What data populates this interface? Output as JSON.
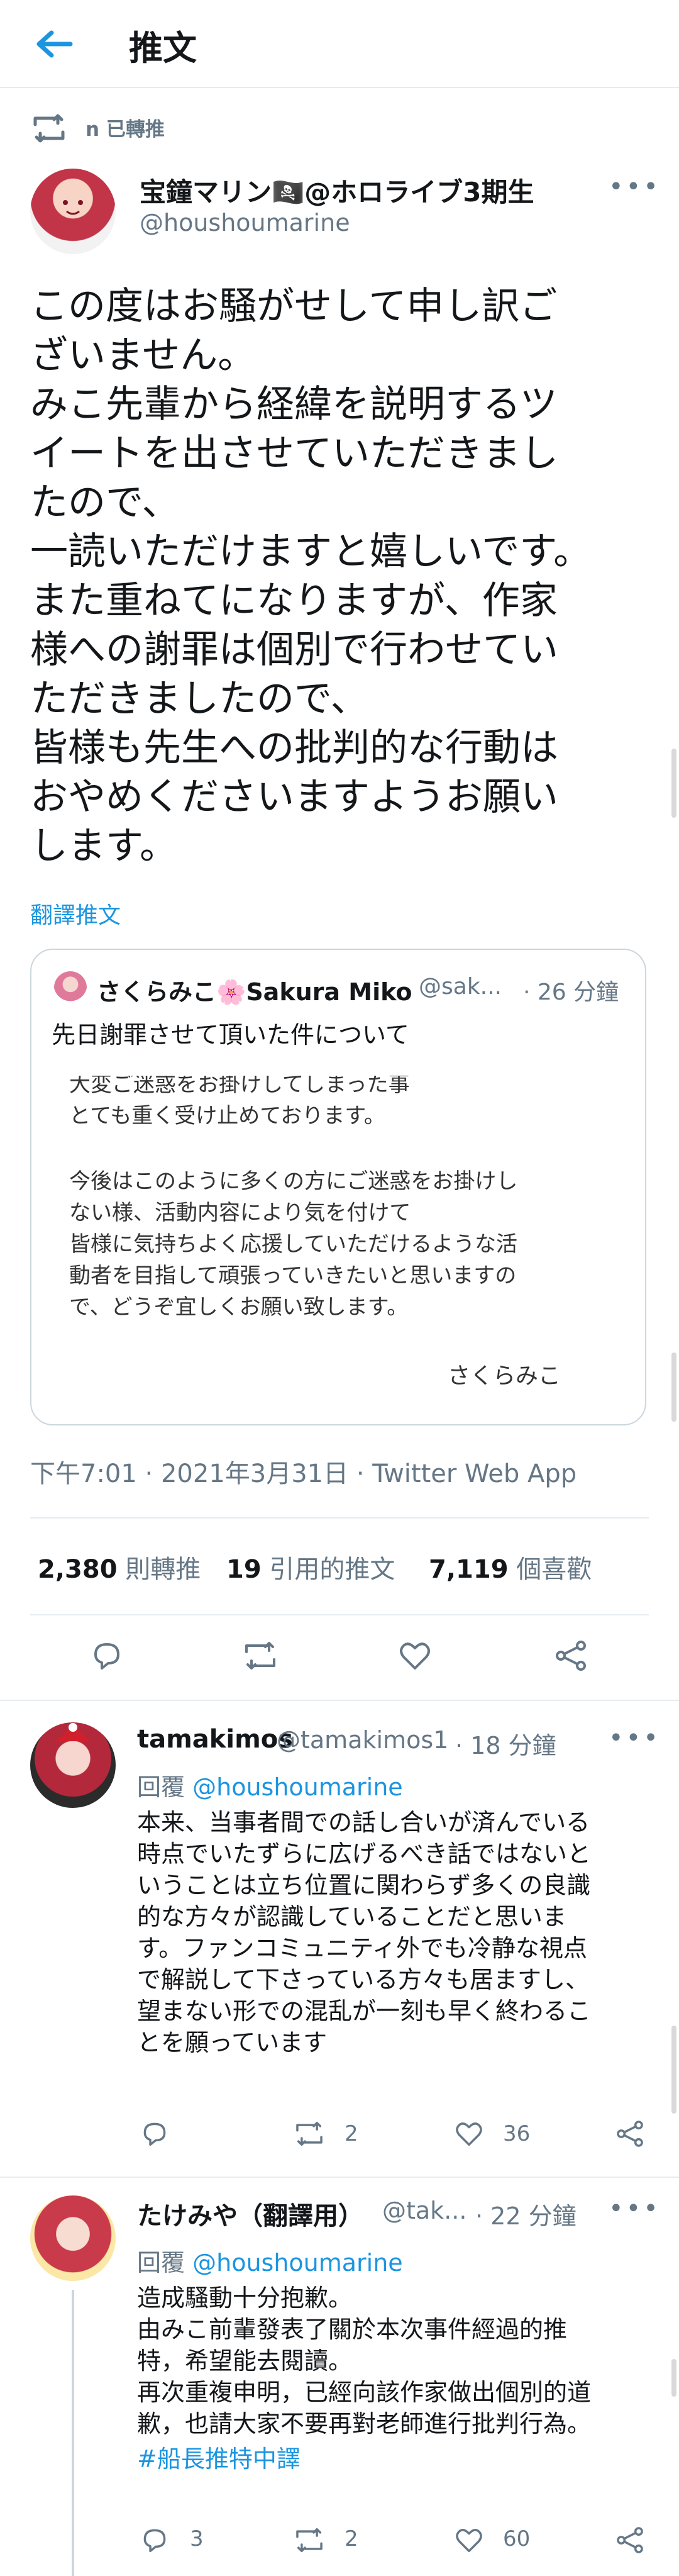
{
  "header": {
    "title": "推文"
  },
  "retweet_label": "n 已轉推",
  "tweet": {
    "author_name": "宝鐘マリン🏴‍☠️@ホロライブ3期生",
    "handle": "@houshoumarine",
    "text": "この度はお騒がせして申し訳ご\nざいません。\nみこ先輩から経緯を説明するツ\nイートを出させていただきまし\nたので、\n一読いただけますと嬉しいです。\nまた重ねてになりますが、作家\n様への謝罪は個別で行わせてい\nただきましたので、\n皆様も先生への批判的な行動は\nおやめくださいますようお願い\nします。",
    "translate_label": "翻譯推文",
    "timestamp": "下午7:01 · 2021年3月31日 · Twitter Web App",
    "stats": {
      "retweets": "2,380",
      "retweets_label": "則轉推",
      "quotes": "19",
      "quotes_label": "引用的推文",
      "likes": "7,119",
      "likes_label": "個喜歡"
    }
  },
  "quote_tweet": {
    "author_name": "さくらみこ🌸Sakura Miko",
    "handle": "@sak...",
    "time": "· 26 分鐘",
    "text": "先日謝罪させて頂いた件について",
    "image_lines": [
      "大変ご迷惑をお掛けしてしまった事",
      "とても重く受け止めております。",
      "",
      "今後はこのように多くの方にご迷惑をお掛けし",
      "ない様、活動内容により気を付けて",
      "皆様に気持ちよく応援していただけるような活",
      "動者を目指して頑張っていきたいと思いますの",
      "で、どうぞ宜しくお願い致します。"
    ],
    "image_signature": "さくらみこ"
  },
  "replies": [
    {
      "name": "tamakimos",
      "handle": "@tamakimos1",
      "time": "· 18 分鐘",
      "reply_to_prefix": "回覆",
      "reply_to": "@houshoumarine",
      "text": "本来、当事者間での話し合いが済んでいる\n時点でいたずらに広げるべき話ではないと\nいうことは立ち位置に関わらず多くの良識\n的な方々が認識していることだと思いま\nす。ファンコミュニティ外でも冷静な視点\nで解説して下さっている方々も居ますし、\n望まない形での混乱が一刻も早く終わるこ\nとを願っています",
      "retweets": "2",
      "likes": "36"
    },
    {
      "name": "たけみや（翻譯用）",
      "handle": "@tak...",
      "time": "· 22 分鐘",
      "reply_to_prefix": "回覆",
      "reply_to": "@houshoumarine",
      "text": "造成騷動十分抱歉。\n由みこ前輩發表了關於本次事件經過的推\n特，希望能去閱讀。\n再次重複申明，已經向該作家做出個別的道\n歉，也請大家不要再對老師進行批判行為。",
      "hashtag": "#船長推特中譯",
      "replies_count": "3",
      "retweets": "2",
      "likes": "60"
    }
  ],
  "colors": {
    "accent": "#1b95e0",
    "muted": "#657786",
    "border": "#e6ecf0"
  }
}
